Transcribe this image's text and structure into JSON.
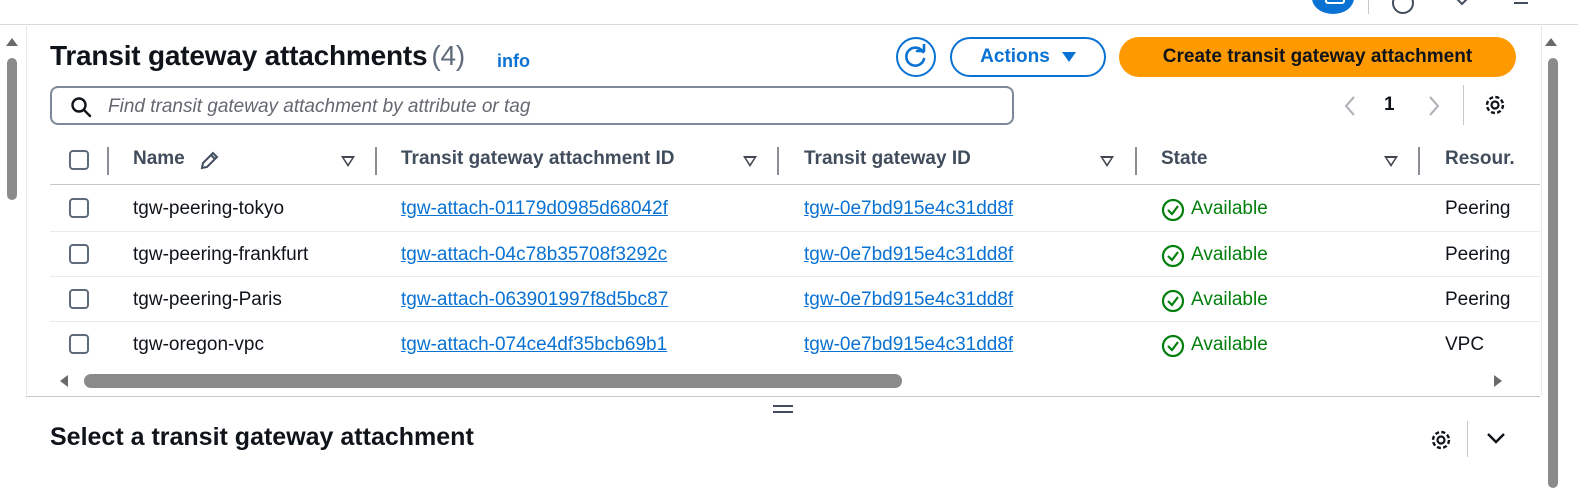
{
  "panel": {
    "title": "Transit gateway attachments",
    "count": "(4)",
    "info_link": "info"
  },
  "toolbar": {
    "refresh_icon": "refresh-icon",
    "actions_label": "Actions",
    "create_label": "Create transit gateway attachment"
  },
  "search": {
    "placeholder": "Find transit gateway attachment by attribute or tag",
    "value": ""
  },
  "pagination": {
    "current_page": "1"
  },
  "table": {
    "columns": [
      "Name",
      "Transit gateway attachment ID",
      "Transit gateway ID",
      "State",
      "Resour."
    ],
    "rows": [
      {
        "name": "tgw-peering-tokyo",
        "attachment_id": "tgw-attach-01179d0985d68042f",
        "tgw_id": "tgw-0e7bd915e4c31dd8f",
        "state": "Available",
        "resource": "Peering"
      },
      {
        "name": "tgw-peering-frankfurt",
        "attachment_id": "tgw-attach-04c78b35708f3292c",
        "tgw_id": "tgw-0e7bd915e4c31dd8f",
        "state": "Available",
        "resource": "Peering"
      },
      {
        "name": "tgw-peering-Paris",
        "attachment_id": "tgw-attach-063901997f8d5bc87",
        "tgw_id": "tgw-0e7bd915e4c31dd8f",
        "state": "Available",
        "resource": "Peering"
      },
      {
        "name": "tgw-oregon-vpc",
        "attachment_id": "tgw-attach-074ce4df35bcb69b1",
        "tgw_id": "tgw-0e7bd915e4c31dd8f",
        "state": "Available",
        "resource": "VPC"
      }
    ]
  },
  "details": {
    "title": "Select a transit gateway attachment"
  },
  "colors": {
    "link": "#0972d3",
    "primary_button": "#ff9900",
    "status_success": "#037f0c"
  }
}
